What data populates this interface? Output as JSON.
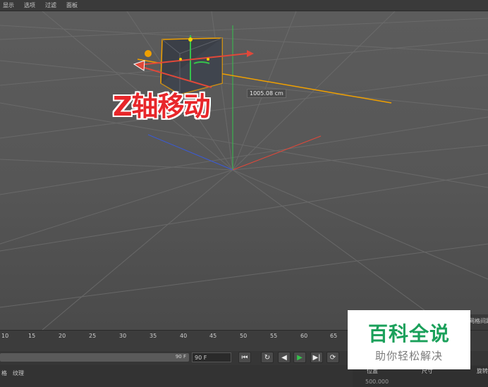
{
  "menu": {
    "items": [
      "显示",
      "选项",
      "过滤",
      "面板"
    ]
  },
  "viewport": {
    "overlay_title": "Z轴移动",
    "measurement": "1005.08 cm",
    "axis_colors": {
      "x": "#e0483a",
      "y": "#35c24c",
      "z": "#3a5ad8",
      "guide": "#f0a000"
    }
  },
  "timeline": {
    "ticks": [
      "10",
      "15",
      "20",
      "25",
      "30",
      "35",
      "40",
      "45",
      "50",
      "55",
      "60",
      "65"
    ]
  },
  "controls": {
    "frame_bar_end": "90 F",
    "frame_field": "90 F",
    "buttons": [
      "⏮",
      "↻",
      "◀",
      "▶",
      "▶|",
      "⟳"
    ]
  },
  "bottom": {
    "tab_left_1": "格",
    "tab_left_2": "纹理"
  },
  "attr": {
    "position": "位置",
    "size": "尺寸",
    "rotation": "旋转",
    "first_value": "500.000"
  },
  "side": {
    "top_label": "网格间距"
  },
  "logo": {
    "title": "百科全说",
    "subtitle": "助你轻松解决"
  }
}
